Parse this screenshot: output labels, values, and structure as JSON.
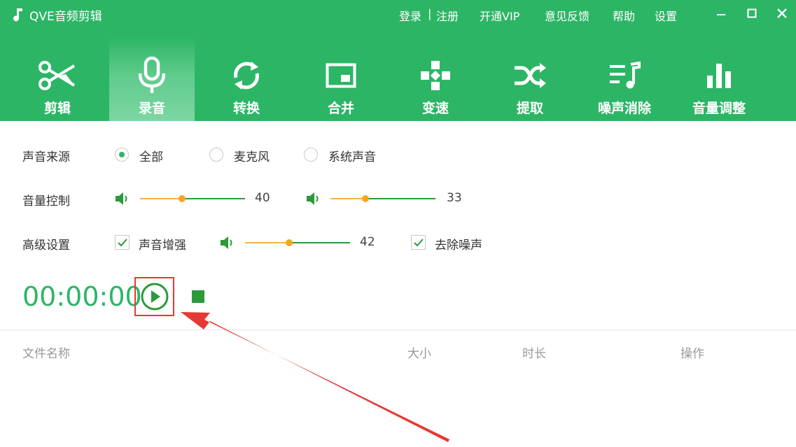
{
  "app": {
    "title": "QVE音频剪辑"
  },
  "top_links": {
    "login": "登录",
    "separator": "|",
    "register": "注册",
    "vip": "开通VIP",
    "feedback": "意见反馈",
    "help": "帮助",
    "settings": "设置"
  },
  "tabs": [
    {
      "label": "剪辑",
      "icon": "scissors-icon",
      "active": false
    },
    {
      "label": "录音",
      "icon": "microphone-icon",
      "active": true
    },
    {
      "label": "转换",
      "icon": "convert-icon",
      "active": false
    },
    {
      "label": "合并",
      "icon": "merge-icon",
      "active": false
    },
    {
      "label": "变速",
      "icon": "speed-icon",
      "active": false
    },
    {
      "label": "提取",
      "icon": "extract-icon",
      "active": false
    },
    {
      "label": "噪声消除",
      "icon": "noise-removal-icon",
      "active": false
    },
    {
      "label": "音量调整",
      "icon": "volume-bars-icon",
      "active": false
    }
  ],
  "sound_source": {
    "label": "声音来源",
    "options": [
      {
        "label": "全部",
        "checked": true
      },
      {
        "label": "麦克风",
        "checked": false
      },
      {
        "label": "系统声音",
        "checked": false
      }
    ]
  },
  "volume_control": {
    "label": "音量控制",
    "sliders": [
      {
        "value": "40",
        "fraction": 0.4
      },
      {
        "value": "33",
        "fraction": 0.33
      }
    ]
  },
  "advanced": {
    "label": "高级设置",
    "enhance": {
      "label": "声音增强",
      "checked": true
    },
    "enhance_slider": {
      "value": "42",
      "fraction": 0.42
    },
    "denoise": {
      "label": "去除噪声",
      "checked": true
    }
  },
  "recorder": {
    "timer": "00:00:00"
  },
  "file_table": {
    "columns": [
      "文件名称",
      "大小",
      "时长",
      "操作"
    ]
  },
  "colors": {
    "brand_green": "#2db566",
    "slider_orange": "#f5b342",
    "annotation_red": "#e53935"
  }
}
